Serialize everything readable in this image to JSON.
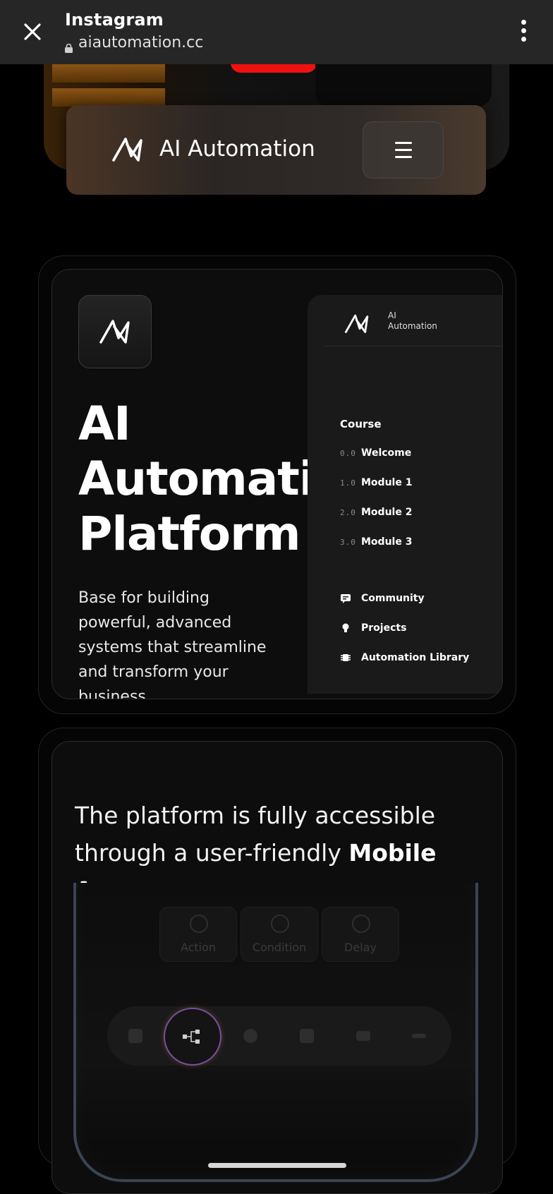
{
  "browser": {
    "app_title": "Instagram",
    "url": "aiautomation.cc"
  },
  "navbar": {
    "brand": "AI Automation"
  },
  "hero": {
    "title": "AI Automation Platform",
    "description": "Base for building powerful, advanced systems that streamline and transform your business"
  },
  "sidebar_preview": {
    "brand": "AI Automation",
    "section_title": "Course",
    "modules": [
      {
        "num": "0.0",
        "label": "Welcome"
      },
      {
        "num": "1.0",
        "label": "Module 1"
      },
      {
        "num": "2.0",
        "label": "Module 2"
      },
      {
        "num": "3.0",
        "label": "Module 3"
      }
    ],
    "links": [
      {
        "label": "Community",
        "icon": "chat-icon"
      },
      {
        "label": "Projects",
        "icon": "lightbulb-icon"
      },
      {
        "label": "Automation Library",
        "icon": "chip-icon"
      }
    ]
  },
  "mobile_section": {
    "heading_prefix": "The platform is fully accessible through a user-friendly",
    "heading_bold": "Mobile App"
  },
  "phone_preview": {
    "chips": [
      "Action",
      "Condition",
      "Delay"
    ]
  },
  "colors": {
    "background": "#000000",
    "topbar": "#262626",
    "card": "#0d0d0d",
    "accent_ring": "#7a4d9e"
  }
}
